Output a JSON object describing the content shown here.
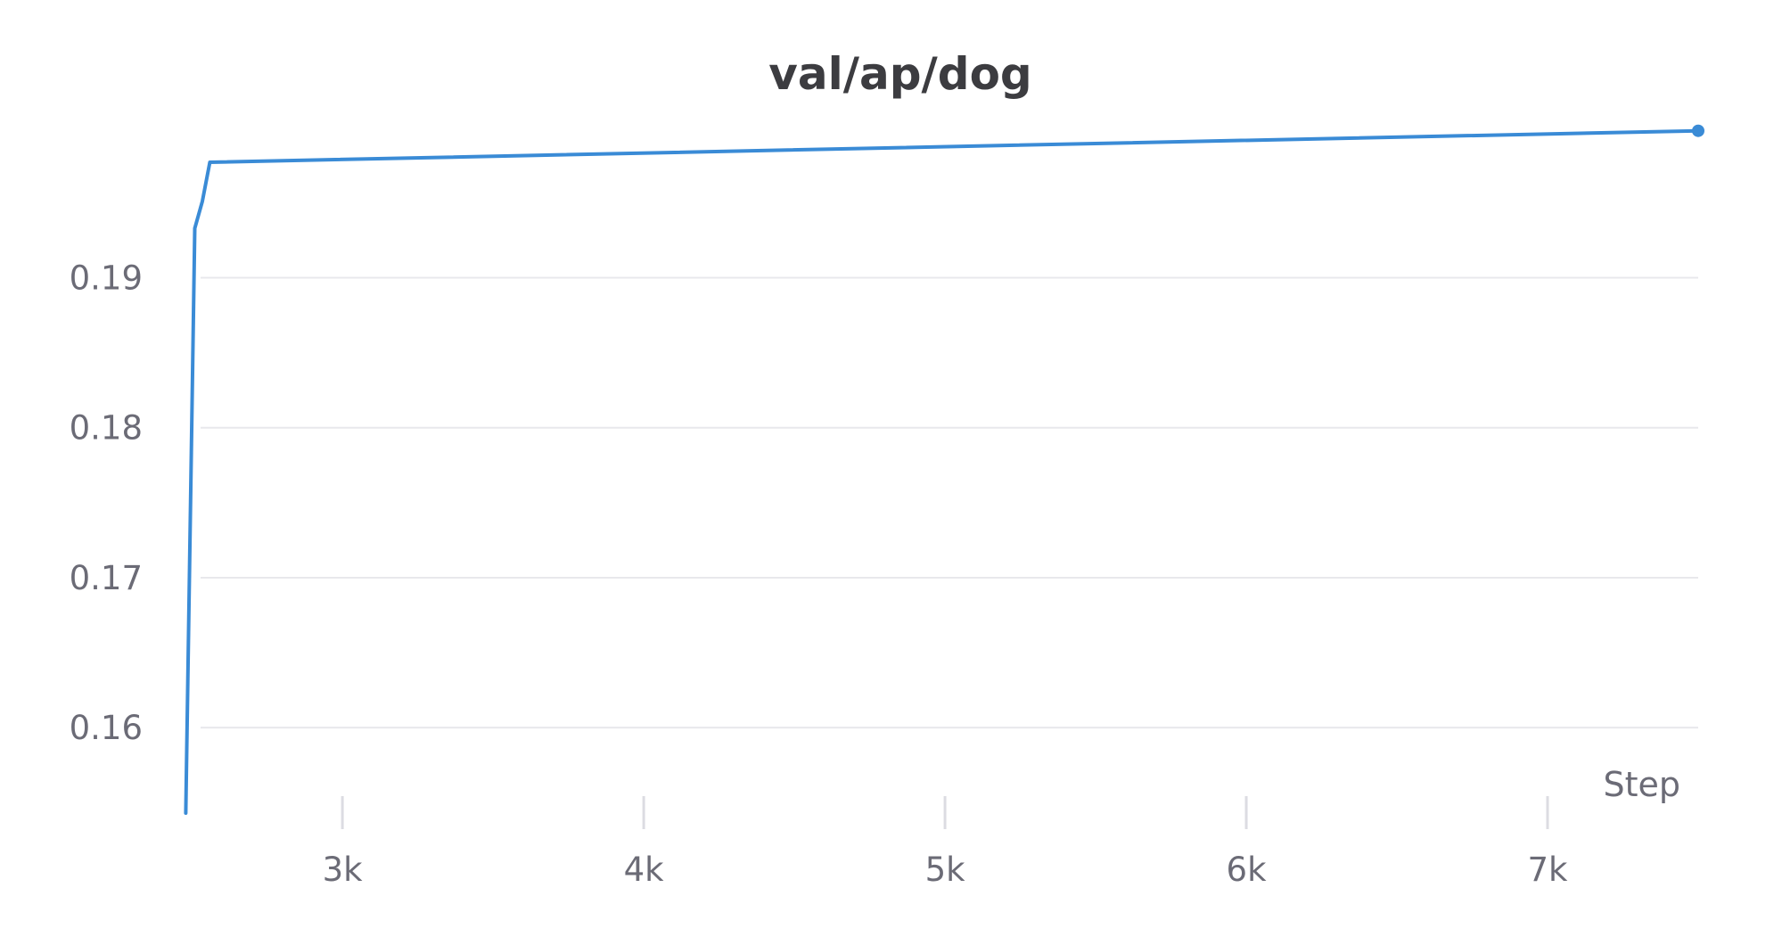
{
  "chart_data": {
    "type": "line",
    "title": "val/ap/dog",
    "xlabel": "Step",
    "ylabel": "",
    "xlim": [
      2470,
      7500
    ],
    "ylim": [
      0.1543,
      0.2002
    ],
    "x_ticks": [
      3000,
      4000,
      5000,
      6000,
      7000
    ],
    "x_tick_labels": [
      "3k",
      "4k",
      "5k",
      "6k",
      "7k"
    ],
    "y_ticks": [
      0.16,
      0.17,
      0.18,
      0.19
    ],
    "y_tick_labels": [
      "0.16",
      "0.17",
      "0.18",
      "0.19"
    ],
    "grid": "horizontal",
    "series": [
      {
        "color": "#3a8bd6",
        "x": [
          2480,
          2510,
          2535,
          2560,
          7500
        ],
        "y": [
          0.1543,
          0.1933,
          0.1951,
          0.1977,
          0.1998
        ]
      }
    ]
  }
}
